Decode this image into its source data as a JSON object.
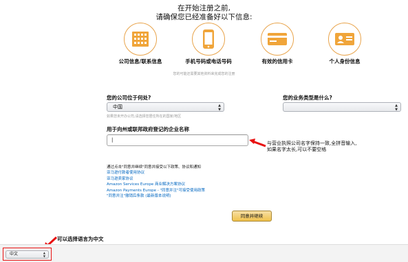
{
  "header": {
    "title": "在开始注册之前,",
    "subtitle": "请确保您已经准备好以下信息:"
  },
  "requirements": [
    {
      "label": "公司信息/联系信息",
      "icon": "building-icon"
    },
    {
      "label": "手机号码或电话号码",
      "icon": "mobile-phone-icon"
    },
    {
      "label": "有效的信用卡",
      "icon": "credit-card-icon"
    },
    {
      "label": "个人身份信息",
      "icon": "id-card-icon"
    }
  ],
  "requirements_note": "您的可能还需要其他资料来完成您的注册",
  "form": {
    "country_label": "您的公司位于何处?",
    "country_value": "中国",
    "country_help": "如果您未开办公司,请选择您居住所在的国家/地区",
    "business_type_label": "您的业务类型是什么?",
    "business_type_value": "",
    "company_name_label": "用于向州或联邦政府登记的企业名称",
    "company_name_value": "|"
  },
  "annotations": {
    "company_name_line1": "与营业执照公司名字保持一致,全拼音输入,",
    "company_name_line2": "如果名字太长,可以不要空格",
    "language_note": "可以选择语言为中文"
  },
  "terms": {
    "intro": "通过点击\"同意并继续\"同意并接受以下政策、协议和通知",
    "links": [
      "亚马逊付款者使用协议",
      "亚马逊卖家协议",
      "Amazon Services Europe 商业解决方案协议",
      "Amazon Payments Europe - \"同意并注\"可接受使用政策",
      "\"同意并注\"撤销后条款 (最新版本说明)"
    ]
  },
  "buttons": {
    "agree_continue": "同意并继续"
  },
  "footer": {
    "language_value": "中文"
  },
  "colors": {
    "icon_accent": "#f0a53a",
    "link": "#0066c0",
    "annotation_red": "#e81010",
    "button_yellow": "#f0c14b"
  }
}
